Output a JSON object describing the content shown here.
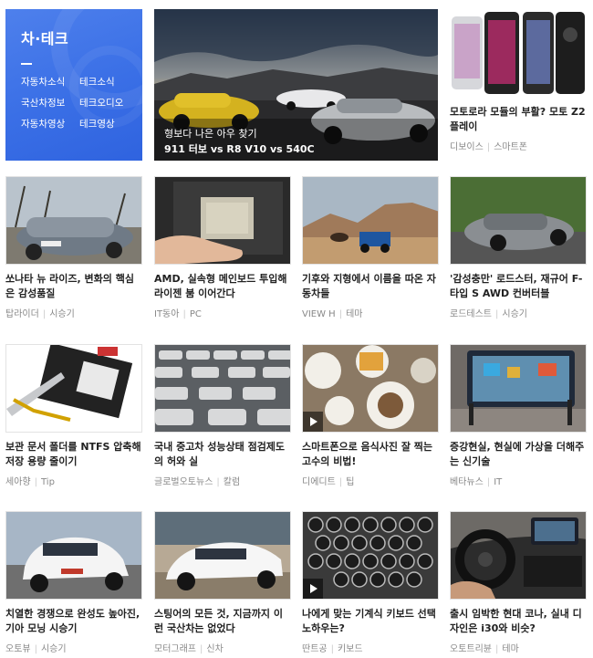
{
  "category": {
    "title": "차·테크",
    "links": [
      "자동차소식",
      "테크소식",
      "국산차정보",
      "테크오디오",
      "자동차영상",
      "테크영상"
    ]
  },
  "feature": {
    "caption_line1": "형보다 나은 아우 찾기",
    "caption_line2": "911 터보 vs R8 V10 vs 540C"
  },
  "cards": [
    {
      "title": "모토로라 모듈의 부활? 모토 Z2 플레이",
      "source": "디보이스",
      "category": "스마트폰"
    },
    {
      "title": "쏘나타 뉴 라이즈, 변화의 핵심은 감성품질",
      "source": "탑라이더",
      "category": "시승기"
    },
    {
      "title": "AMD, 실속형 메인보드 투입해 라이젠 붐 이어간다",
      "source": "IT동아",
      "category": "PC"
    },
    {
      "title": "기후와 지형에서 이름을 따온 자동차들",
      "source": "VIEW H",
      "category": "테마"
    },
    {
      "title": "'감성충만' 로드스터, 재규어 F-타입 S AWD 컨버터블",
      "source": "로드테스트",
      "category": "시승기"
    },
    {
      "title": "보관 문서 폴더를 NTFS 압축해 저장 용량 줄이기",
      "source": "세아향",
      "category": "Tip"
    },
    {
      "title": "국내 중고차 성능상태 점검제도의 허와 실",
      "source": "글로벌오토뉴스",
      "category": "칼럼"
    },
    {
      "title": "스마트폰으로 음식사진 잘 찍는 고수의 비법!",
      "source": "디에디트",
      "category": "팁"
    },
    {
      "title": "증강현실, 현실에 가상을 더해주는 신기술",
      "source": "베타뉴스",
      "category": "IT"
    },
    {
      "title": "치열한 경쟁으로 완성도 높아진, 기아 모닝 시승기",
      "source": "오토뷰",
      "category": "시승기"
    },
    {
      "title": "스팅어의 모든 것, 지금까지 이런 국산차는 없었다",
      "source": "모터그래프",
      "category": "신차"
    },
    {
      "title": "나에게 맞는 기계식 키보드 선택 노하우는?",
      "source": "딴트공",
      "category": "키보드"
    },
    {
      "title": "출시 임박한 현대 코나, 실내 디자인은 i30와 비슷?",
      "source": "오토트리뷴",
      "category": "테마"
    }
  ]
}
